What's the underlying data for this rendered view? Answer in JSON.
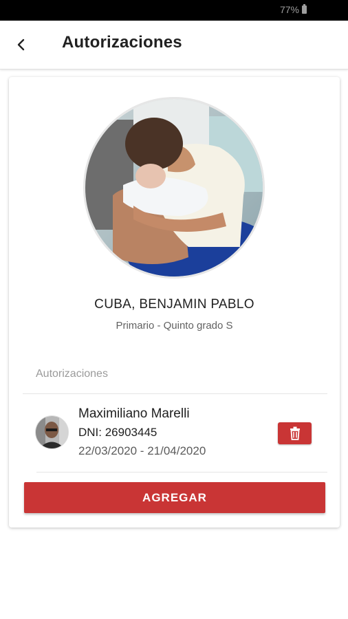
{
  "status_bar": {
    "battery_percent": "77%",
    "battery_icon": "battery-icon"
  },
  "app_bar": {
    "back_icon": "chevron-left-icon",
    "title": "Autorizaciones"
  },
  "student": {
    "photo_icon": "student-photo",
    "name": "CUBA, BENJAMIN PABLO",
    "level": "Primario - Quinto grado S"
  },
  "authorizations": {
    "section_title": "Autorizaciones",
    "items": [
      {
        "avatar_icon": "person-avatar",
        "name": "Maximiliano Marelli",
        "dni": "DNI: 26903445",
        "dates": "22/03/2020 - 21/04/2020",
        "delete_icon": "trash-icon"
      }
    ],
    "add_label": "AGREGAR"
  },
  "colors": {
    "accent": "#c93535",
    "status_bar": "#000000",
    "title_text": "#212121"
  }
}
